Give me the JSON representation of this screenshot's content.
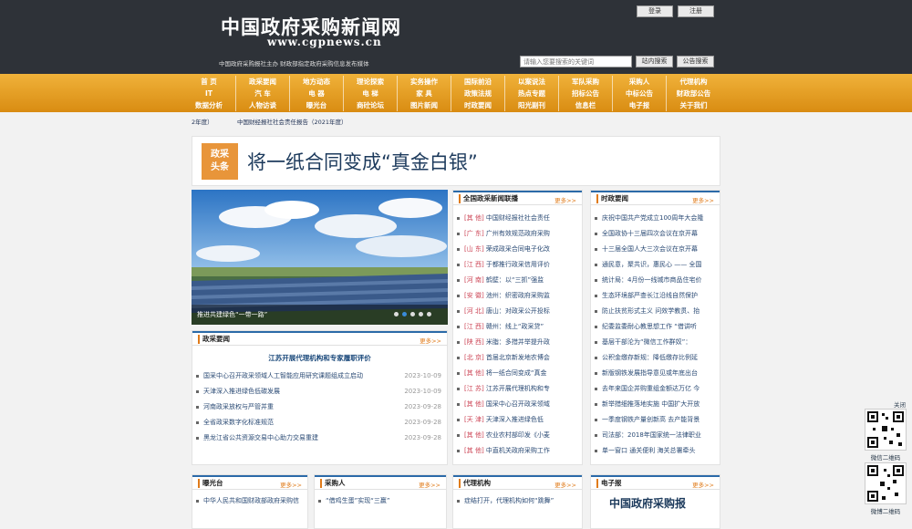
{
  "header": {
    "logo_cn": "中国政府采购新闻网",
    "logo_url": "www.cgpnews.cn",
    "tagline": "中国政府采购报社主办  财政部指定政府采购信息发布媒体",
    "login": "登录",
    "register": "注册",
    "search_placeholder": "请输入您要搜索的关键词",
    "site_search": "站内搜索",
    "notice_search": "公告搜索"
  },
  "nav": {
    "row1": [
      "首  页",
      "政采要闻",
      "地方动态",
      "理论探索",
      "实务操作",
      "国际前沿",
      "以案说法",
      "军队采购",
      "采购人",
      "代理机构"
    ],
    "row2": [
      "IT",
      "汽  车",
      "电  器",
      "电  梯",
      "家  具",
      "政策法规",
      "热点专题",
      "招标公告",
      "中标公告",
      "财政部公告"
    ],
    "row3": [
      "数据分析",
      "人物访谈",
      "曝光台",
      "商砼论坛",
      "图片新闻",
      "时政要闻",
      "阳光副刊",
      "信息栏",
      "电子报",
      "关于我们"
    ]
  },
  "ticker": {
    "left": "2年度）",
    "right": "中国财经报社社会责任报告（2021年度）"
  },
  "headline": {
    "badge_line1": "政采",
    "badge_line2": "头条",
    "title": "将一纸合同变成“真金白银”"
  },
  "slider": {
    "caption": "推进共建绿色“一带一路”",
    "dot_count": 5,
    "active_dot": 1
  },
  "zhengcai": {
    "title": "政采要闻",
    "more": "更多>>",
    "headline": "江苏开展代理机构和专家履职评价",
    "items": [
      {
        "text": "国采中心召开政采领域人工智能应用研究课题组成立启动",
        "date": "2023-10-09"
      },
      {
        "text": "天津深入推进绿色低碳发展",
        "date": "2023-10-09"
      },
      {
        "text": "河南政采放权与严管并重",
        "date": "2023-09-28"
      },
      {
        "text": "全省政采数字化标准规范",
        "date": "2023-09-28"
      },
      {
        "text": "黑龙江省公共资源交易中心助力交易重建",
        "date": "2023-09-28"
      }
    ]
  },
  "lianbo": {
    "title": "全国政采新闻联播",
    "more": "更多>>",
    "items": [
      {
        "region": "[其    他]",
        "text": "中国财经报社社会责任"
      },
      {
        "region": "[广    东]",
        "text": "广州有效规范政府采购"
      },
      {
        "region": "[山    东]",
        "text": "荣成政采合同电子化改"
      },
      {
        "region": "[江    西]",
        "text": "于都推行政采信用评价"
      },
      {
        "region": "[河    南]",
        "text": "鹤壁：以“三抓”强监"
      },
      {
        "region": "[安    徽]",
        "text": "池州：织密政府采购监"
      },
      {
        "region": "[河    北]",
        "text": "唐山：对政采公开投标"
      },
      {
        "region": "[江    西]",
        "text": "赣州：线上“政采贷”"
      },
      {
        "region": "[陕    西]",
        "text": "米脂：多措并举提升政"
      },
      {
        "region": "[北    京]",
        "text": "首届北京新发地农博会"
      },
      {
        "region": "[其    他]",
        "text": "将一纸合同变成“真金"
      },
      {
        "region": "[江    苏]",
        "text": "江苏开展代理机构和专"
      },
      {
        "region": "[其    他]",
        "text": "国采中心召开政采领域"
      },
      {
        "region": "[天    津]",
        "text": "天津深入推进绿色低"
      },
      {
        "region": "[其    他]",
        "text": "农业农村部印发《小麦"
      },
      {
        "region": "[其    他]",
        "text": "中直机关政府采购工作"
      }
    ]
  },
  "shizheng": {
    "title": "时政要闻",
    "more": "更多>>",
    "items": [
      "庆祝中国共产党成立100周年大会隆",
      "全国政协十三届四次会议在京开幕",
      "十三届全国人大三次会议在京开幕",
      "通民意，聚共识，惠民心 —— 全国",
      "统计局：4月份一线城市商品住宅价",
      "生态环境部严查长江沿线自然保护",
      "防止扶贫形式主义 问效学教贯、抬",
      "纪委监委耐心教思想工作 “借讲听",
      "基层干部沦为“微信工作群奴”：",
      "公积金缴存新规：降低缴存比例延",
      "新版钢铁发展指导意见或年底出台",
      "去年来国企并购重组金额达万亿 今",
      "新举措细推落地实施 中国扩大开放",
      "一季度钢铁产量创新高 去产能背景",
      "司法部：2018年国家统一法律职业",
      "单一窗口 通关便利 海关总署牵头"
    ]
  },
  "bottom": {
    "baoguang": {
      "title": "曝光台",
      "more": "更多>>",
      "items": [
        "中华人民共和国财政部政府采购信"
      ]
    },
    "caigouren": {
      "title": "采购人",
      "more": "更多>>",
      "items": [
        "“借鸡生蛋”实现“三赢”"
      ]
    },
    "daili": {
      "title": "代理机构",
      "more": "更多>>",
      "items": [
        "症结打开，代理机构如何“跳舞”"
      ]
    },
    "dianzibao": {
      "title": "电子报",
      "more": "更多>>",
      "paper_name": "中国政府采购报"
    }
  },
  "side": {
    "close": "关闭",
    "qr1_label": "微信二维码",
    "qr2_label": "微博二维码"
  }
}
